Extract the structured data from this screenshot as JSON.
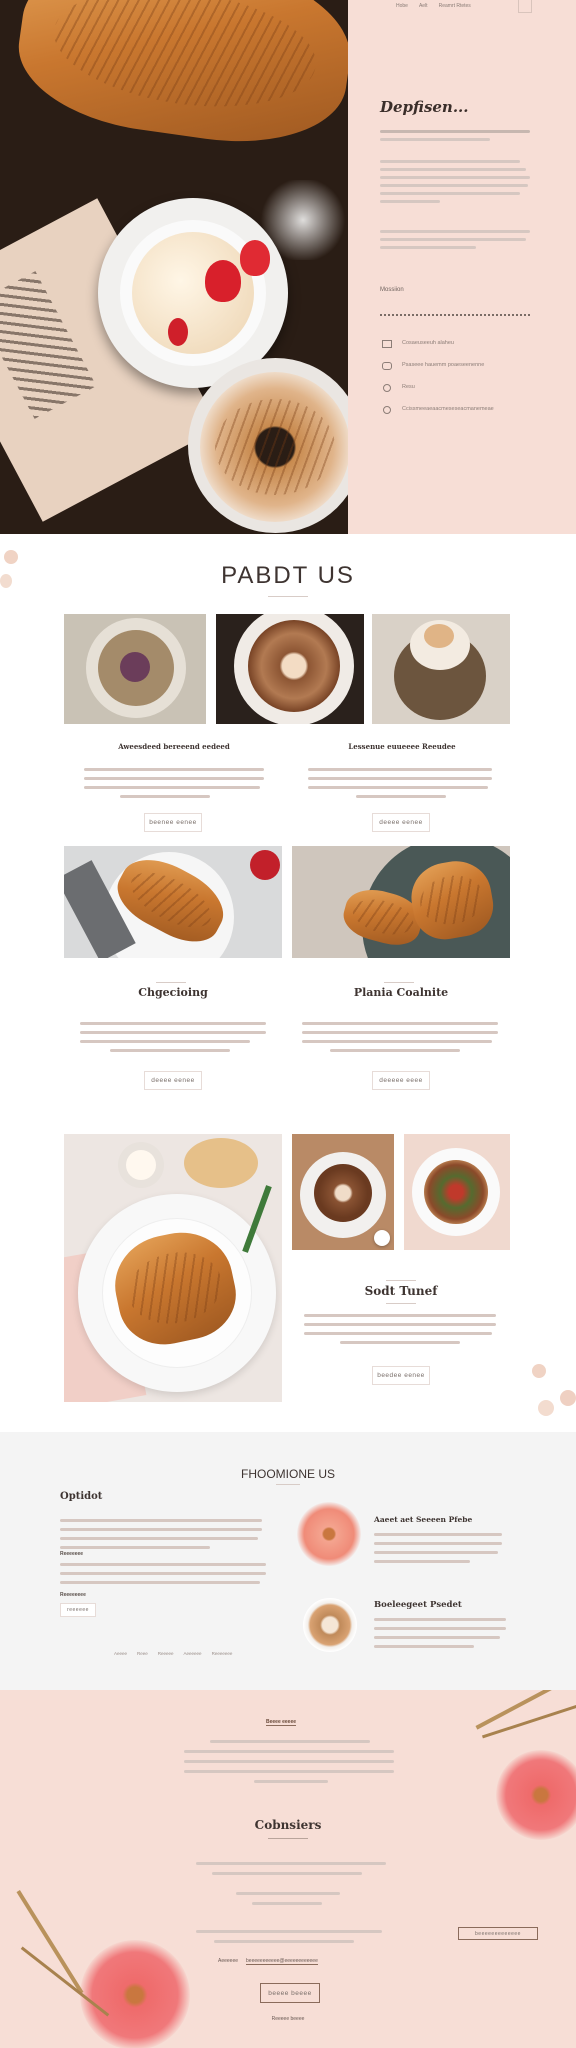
{
  "nav": {
    "items": [
      "Hobe",
      "Aelt",
      "Reamrt Rtetes"
    ],
    "menu_icon": "hamburger-menu-icon"
  },
  "hero": {
    "title": "Depfisen...",
    "photo_icon": "croissant-coffee-photo",
    "section_label": "Mossiion",
    "features": [
      {
        "icon": "mail-icon",
        "text": "Cosaeuseeuh alaheu"
      },
      {
        "icon": "link-icon",
        "text": "Psaseee hauemm poaeseenenne"
      },
      {
        "icon": "location-pin-icon",
        "text": "Resu"
      },
      {
        "icon": "phone-icon",
        "text": "Ccissmeeaeaacmeseseacmanemeae"
      }
    ]
  },
  "about": {
    "title": "PABDT US",
    "cards": [
      {
        "title": "Aweesdeed bereeend eedeed",
        "button": "Beenee eenee"
      },
      {
        "title": "Lessenue euueeee Reeudee",
        "button": "Deeee eenee"
      },
      {
        "title": "Chgecioing",
        "button": "Deeee eenee"
      },
      {
        "title": "Plania Coalnite",
        "button": "Deeeee eeee"
      },
      {
        "title": "Sodt Tunef",
        "button": "Beedee eenee"
      }
    ]
  },
  "promo": {
    "title": "FHOOMIONE US",
    "left_heading": "Optidot",
    "left_sublabel_1": "Reeeeeee",
    "left_sublabel_2": "Reeeeeeee",
    "left_small_button": "Reeeeee",
    "pager": [
      "Aeeee",
      "Reee",
      "Reeeee",
      "Aeeeeee",
      "Reeeeeee"
    ],
    "items": [
      {
        "title": "Aaeet aet Seeeen Pfebe",
        "icon": "pink-flower-icon"
      },
      {
        "title": "Boeleegeet Psedet",
        "icon": "latte-art-icon"
      }
    ]
  },
  "contact": {
    "badge": "Beeee eeeee",
    "title": "Cobnsiers",
    "outline_button": "Beeeeeeeeeeeee",
    "email_label": "Aeeeeee",
    "email_value": "beeeeeeeeeee@eeeeeeeeeeee",
    "cta_button": "Beeee beeee",
    "footer_link": "Reeeee beeee"
  },
  "colors": {
    "blush": "#f7ded6",
    "dark_text": "#3e3431",
    "accent_flower": "#ef6b6b"
  }
}
